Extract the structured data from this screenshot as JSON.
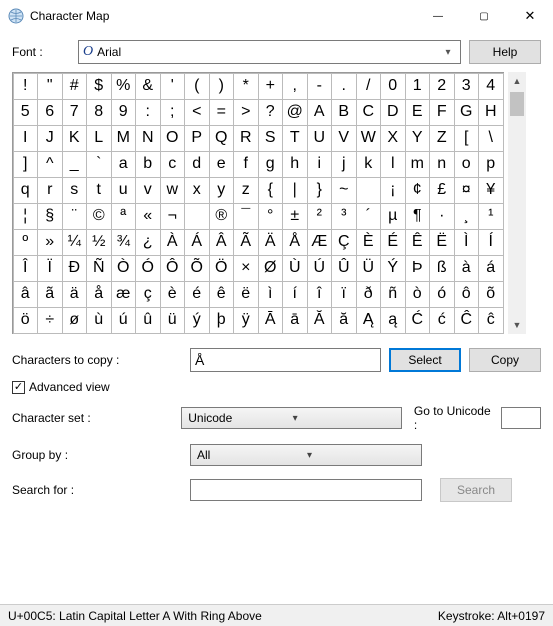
{
  "window": {
    "title": "Character Map",
    "min": "—",
    "max": "▢",
    "close": "✕"
  },
  "font": {
    "label": "Font :",
    "icon": "O",
    "value": "Arial",
    "help": "Help"
  },
  "grid": {
    "chars": [
      "!",
      "\"",
      "#",
      "$",
      "%",
      "&",
      "'",
      "(",
      ")",
      "*",
      "+",
      ",",
      "-",
      ".",
      "/",
      "0",
      "1",
      "2",
      "3",
      "4",
      "5",
      "6",
      "7",
      "8",
      "9",
      ":",
      ";",
      "<",
      "=",
      ">",
      "?",
      "@",
      "A",
      "B",
      "C",
      "D",
      "E",
      "F",
      "G",
      "H",
      "I",
      "J",
      "K",
      "L",
      "M",
      "N",
      "O",
      "P",
      "Q",
      "R",
      "S",
      "T",
      "U",
      "V",
      "W",
      "X",
      "Y",
      "Z",
      "[",
      "\\",
      "]",
      "^",
      "_",
      "`",
      "a",
      "b",
      "c",
      "d",
      "e",
      "f",
      "g",
      "h",
      "i",
      "j",
      "k",
      "l",
      "m",
      "n",
      "o",
      "p",
      "q",
      "r",
      "s",
      "t",
      "u",
      "v",
      "w",
      "x",
      "y",
      "z",
      "{",
      "|",
      "}",
      "~",
      " ",
      "¡",
      "¢",
      "£",
      "¤",
      "¥",
      "¦",
      "§",
      "¨",
      "©",
      "ª",
      "«",
      "¬",
      " ",
      "®",
      "¯",
      "°",
      "±",
      "²",
      "³",
      "´",
      "µ",
      "¶",
      "·",
      "¸",
      "¹",
      "º",
      "»",
      "¼",
      "½",
      "¾",
      "¿",
      "À",
      "Á",
      "Â",
      "Ã",
      "Ä",
      "Å",
      "Æ",
      "Ç",
      "È",
      "É",
      "Ê",
      "Ë",
      "Ì",
      "Í",
      "Î",
      "Ï",
      "Ð",
      "Ñ",
      "Ò",
      "Ó",
      "Ô",
      "Õ",
      "Ö",
      "×",
      "Ø",
      "Ù",
      "Ú",
      "Û",
      "Ü",
      "Ý",
      "Þ",
      "ß",
      "à",
      "á",
      "â",
      "ã",
      "ä",
      "å",
      "æ",
      "ç",
      "è",
      "é",
      "ê",
      "ë",
      "ì",
      "í",
      "î",
      "ï",
      "ð",
      "ñ",
      "ò",
      "ó",
      "ô",
      "õ",
      "ö",
      "÷",
      "ø",
      "ù",
      "ú",
      "û",
      "ü",
      "ý",
      "þ",
      "ÿ",
      "Ā",
      "ā",
      "Ă",
      "ă",
      "Ą",
      "ą",
      "Ć",
      "ć",
      "Ĉ",
      "ĉ"
    ]
  },
  "copy": {
    "label": "Characters to copy :",
    "value": "Å",
    "select": "Select",
    "copybtn": "Copy"
  },
  "advanced": {
    "label": "Advanced view",
    "checked": "✓"
  },
  "charset": {
    "label": "Character set :",
    "value": "Unicode",
    "goto_label": "Go to Unicode :",
    "goto_value": ""
  },
  "groupby": {
    "label": "Group by :",
    "value": "All"
  },
  "search": {
    "label": "Search for :",
    "value": "",
    "btn": "Search"
  },
  "status": {
    "left": "U+00C5: Latin Capital Letter A With Ring Above",
    "right": "Keystroke: Alt+0197"
  }
}
